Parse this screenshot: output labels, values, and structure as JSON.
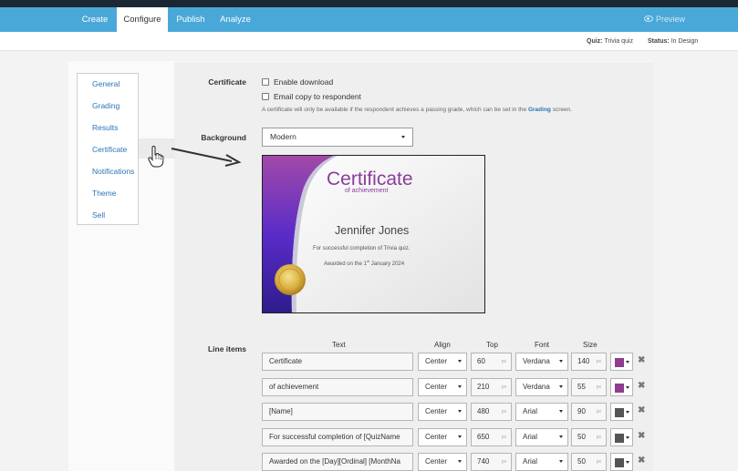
{
  "nav": {
    "tabs": [
      {
        "label": "Create"
      },
      {
        "label": "Configure"
      },
      {
        "label": "Publish"
      },
      {
        "label": "Analyze"
      }
    ],
    "preview_label": "Preview"
  },
  "status": {
    "quiz_label": "Quiz:",
    "quiz_value": "Trivia quiz",
    "status_label": "Status:",
    "status_value": "In Design"
  },
  "sidebar": {
    "items": [
      {
        "label": "General"
      },
      {
        "label": "Grading"
      },
      {
        "label": "Results"
      },
      {
        "label": "Certificate"
      },
      {
        "label": "Notifications"
      },
      {
        "label": "Theme"
      },
      {
        "label": "Sell"
      }
    ]
  },
  "certificate": {
    "section_label": "Certificate",
    "enable_download": "Enable download",
    "email_copy": "Email copy to respondent",
    "note_prefix": "A certificate will only be available if the respondent achieves a passing grade, which can be set in the",
    "note_link": "Grading",
    "note_suffix": "screen."
  },
  "background": {
    "label": "Background",
    "selected": "Modern"
  },
  "preview_cert": {
    "title": "Certificate",
    "subtitle": "of achievement",
    "name": "Jennifer Jones",
    "line1": "For successful completion of Trivia quiz.",
    "line2_prefix": "Awarded on the 1",
    "line2_sup": "st",
    "line2_suffix": "January 2024"
  },
  "line_items": {
    "label": "Line items",
    "headers": {
      "text": "Text",
      "align": "Align",
      "top": "Top",
      "font": "Font",
      "size": "Size"
    },
    "unit": "px",
    "rows": [
      {
        "text": "Certificate",
        "align": "Center",
        "top": "60",
        "font": "Verdana",
        "size": "140",
        "color": "#8e3d8e"
      },
      {
        "text": "of achievement",
        "align": "Center",
        "top": "210",
        "font": "Verdana",
        "size": "55",
        "color": "#8e3d8e"
      },
      {
        "text": "[Name]",
        "align": "Center",
        "top": "480",
        "font": "Arial",
        "size": "90",
        "color": "#555555"
      },
      {
        "text": "For successful completion of [QuizName",
        "align": "Center",
        "top": "650",
        "font": "Arial",
        "size": "50",
        "color": "#555555"
      },
      {
        "text": "Awarded on the [Day][Ordinal] [MonthNa",
        "align": "Center",
        "top": "740",
        "font": "Arial",
        "size": "50",
        "color": "#555555"
      }
    ]
  },
  "colors": {
    "nav_bg": "#4aa8d8",
    "link": "#2b74b8",
    "cert_purple": "#8a3d9c"
  }
}
